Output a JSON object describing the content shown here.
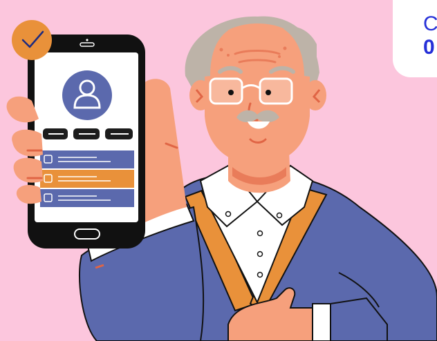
{
  "corner_text": {
    "line1": "C",
    "line2": "0"
  },
  "icons": {
    "badge": "checkmark-icon",
    "profile": "user-icon",
    "checkbox": "checkbox-icon",
    "earpiece": "speaker-icon",
    "home": "home-button-icon"
  },
  "colors": {
    "background": "#fcc6dd",
    "corner_card": "#ffffff",
    "corner_text": "#2630d8",
    "primary_blue": "#5b69ad",
    "accent_orange": "#e9913a",
    "skin": "#f6a07c",
    "phone_body": "#111111"
  }
}
